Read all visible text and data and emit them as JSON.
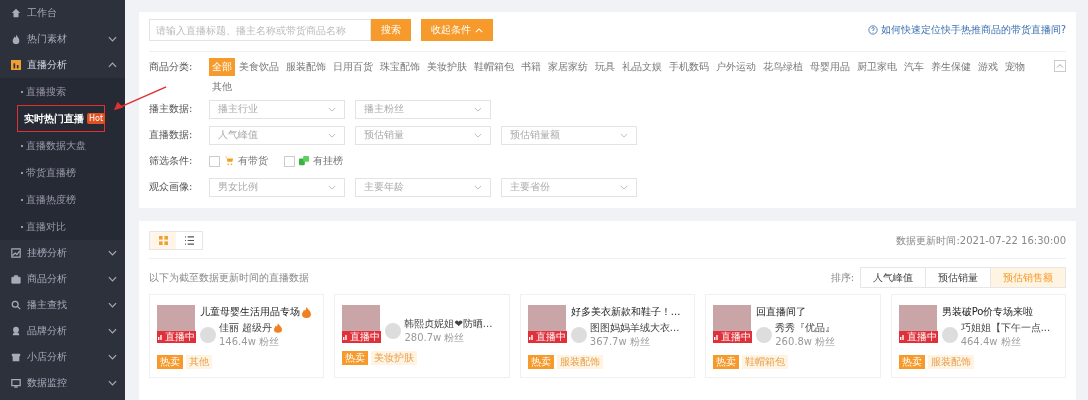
{
  "sidebar": {
    "items": [
      {
        "label": "工作台"
      },
      {
        "label": "热门素材",
        "expanded": false
      },
      {
        "label": "直播分析",
        "expanded": true,
        "children": [
          {
            "label": "直播搜索",
            "selected": false
          },
          {
            "label": "实时热门直播",
            "selected": true,
            "badge": "Hot"
          },
          {
            "label": "直播数据大盘",
            "selected": false
          },
          {
            "label": "带货直播榜",
            "selected": false
          },
          {
            "label": "直播热度榜",
            "selected": false
          },
          {
            "label": "直播对比",
            "selected": false
          }
        ]
      },
      {
        "label": "挂榜分析",
        "expanded": false
      },
      {
        "label": "商品分析",
        "expanded": false
      },
      {
        "label": "播主查找",
        "expanded": false
      },
      {
        "label": "品牌分析",
        "expanded": false
      },
      {
        "label": "小店分析",
        "expanded": false
      },
      {
        "label": "数据监控",
        "expanded": false
      }
    ]
  },
  "search": {
    "placeholder": "请输入直播标题、播主名称或带货商品名称",
    "button": "搜索",
    "collapse_button": "收起条件",
    "help_link": "如何快速定位快手热推商品的带货直播间?"
  },
  "category_filter": {
    "label": "商品分类:",
    "options": [
      {
        "label": "全部",
        "selected": true
      },
      {
        "label": "美食饮品",
        "selected": false
      },
      {
        "label": "服装配饰",
        "selected": false
      },
      {
        "label": "日用百货",
        "selected": false
      },
      {
        "label": "珠宝配饰",
        "selected": false
      },
      {
        "label": "美妆护肤",
        "selected": false
      },
      {
        "label": "鞋帽箱包",
        "selected": false
      },
      {
        "label": "书籍",
        "selected": false
      },
      {
        "label": "家居家纺",
        "selected": false
      },
      {
        "label": "玩具",
        "selected": false
      },
      {
        "label": "礼品文娱",
        "selected": false
      },
      {
        "label": "手机数码",
        "selected": false
      },
      {
        "label": "户外运动",
        "selected": false
      },
      {
        "label": "花鸟绿植",
        "selected": false
      },
      {
        "label": "母婴用品",
        "selected": false
      },
      {
        "label": "厨卫家电",
        "selected": false
      },
      {
        "label": "汽车",
        "selected": false
      },
      {
        "label": "养生保健",
        "selected": false
      },
      {
        "label": "游戏",
        "selected": false
      },
      {
        "label": "宠物",
        "selected": false
      },
      {
        "label": "其他",
        "selected": false
      }
    ]
  },
  "filter_rows": [
    {
      "kind": "selects",
      "label": "播主数据:",
      "selects": [
        "播主行业",
        "播主粉丝"
      ]
    },
    {
      "kind": "selects",
      "label": "直播数据:",
      "selects": [
        "人气峰值",
        "预估销量",
        "预估销量额"
      ]
    },
    {
      "kind": "checks",
      "label": "筛选条件:",
      "checks": [
        {
          "label": "有带货",
          "checked": false
        },
        {
          "label": "有挂榜",
          "checked": false
        }
      ]
    },
    {
      "kind": "selects",
      "label": "观众画像:",
      "selects": [
        "男女比例",
        "主要年龄",
        "主要省份"
      ]
    }
  ],
  "results": {
    "view_modes": [
      {
        "selected": true
      },
      {
        "selected": false
      }
    ],
    "updated": "数据更新时间:2021-07-22 16:30:00",
    "note": "以下为截至数据更新时间的直播数据",
    "sort_label": "排序:",
    "sort_options": [
      {
        "label": "人气峰值",
        "selected": false
      },
      {
        "label": "预估销量",
        "selected": false
      },
      {
        "label": "预估销售额",
        "selected": true
      }
    ],
    "cards": [
      {
        "title": "儿童母婴生活用品专场",
        "title_fire": true,
        "name": "佳丽 超级丹",
        "name_fire": true,
        "fans": "146.4w 粉丝",
        "live": "直播中",
        "hot": "热卖",
        "category": "其他"
      },
      {
        "name": "韩熙贞妮姐❤防晒...",
        "name_fire": false,
        "fans": "280.7w 粉丝",
        "live": "直播中",
        "hot": "热卖",
        "category": "美妆护肤"
      },
      {
        "title": "好多美衣新款和鞋子！...",
        "title_fire": false,
        "name": "图图妈妈羊绒大衣...",
        "name_fire": false,
        "fans": "367.7w 粉丝",
        "live": "直播中",
        "hot": "热卖",
        "category": "服装配饰"
      },
      {
        "title": "回直播间了",
        "title_fire": false,
        "name": "秀秀『优品』",
        "name_fire": false,
        "fans": "260.8w 粉丝",
        "live": "直播中",
        "hot": "热卖",
        "category": "鞋帽箱包"
      },
      {
        "title": "男装破Po价专场来啦",
        "title_fire": false,
        "name": "巧姐姐【下午一点...",
        "name_fire": false,
        "fans": "464.4w 粉丝",
        "live": "直播中",
        "hot": "热卖",
        "category": "服装配饰"
      }
    ]
  }
}
